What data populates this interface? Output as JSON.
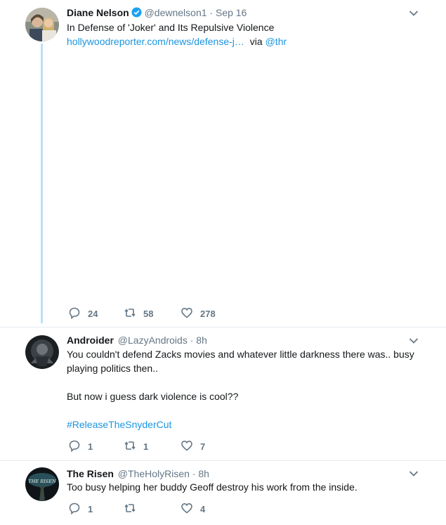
{
  "tweets": [
    {
      "name": "Diane Nelson",
      "handle": "@dewnelson1",
      "separator": "·",
      "time": "Sep 16",
      "text_line1": "In Defense of 'Joker' and Its Repulsive Violence",
      "link": "hollywoodreporter.com/news/defense-j…",
      "via": "via",
      "mention": "@thr",
      "replies": "24",
      "retweets": "58",
      "likes": "278"
    },
    {
      "name": "Androider",
      "handle": "@LazyAndroids",
      "separator": "·",
      "time": "8h",
      "text_line1": "You couldn't defend Zacks movies and whatever little darkness there was.. busy",
      "text_line2": "playing politics then..",
      "text_line3": "But now i guess dark violence is cool??",
      "hashtag": "#ReleaseTheSnyderCut",
      "replies": "1",
      "retweets": "1",
      "likes": "7"
    },
    {
      "name": "The Risen",
      "handle": "@TheHolyRisen",
      "separator": "·",
      "time": "8h",
      "text_line1": "Too busy helping her buddy Geoff destroy his work from the inside.",
      "avatar_text": "THE RISEN",
      "replies": "1",
      "retweets": "",
      "likes": "4"
    }
  ],
  "colors": {
    "link": "#1b95e0",
    "muted": "#657786",
    "thread": "#bde0f5",
    "verified": "#1da1f2"
  },
  "icons": [
    "reply-icon",
    "retweet-icon",
    "like-icon",
    "chevron-down-icon",
    "verified-badge-icon"
  ]
}
